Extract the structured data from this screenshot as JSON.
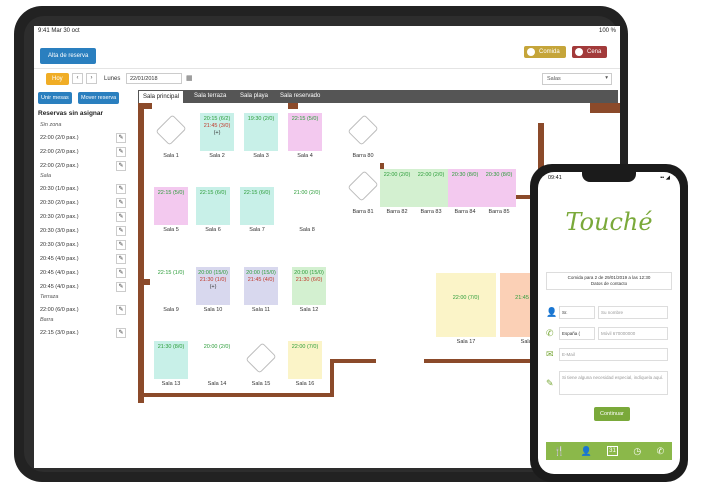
{
  "ipad": {
    "status_time": "9:41 Mar 30 oct",
    "status_right": "100 %",
    "alta_button": "Alta de reserva",
    "comida_label": "Comida",
    "cena_label": "Cena",
    "hoy_button": "Hoy",
    "prev_icon": "chevron-left-icon",
    "next_icon": "chevron-right-icon",
    "day_label": "Lunes",
    "date_value": "22/01/2018",
    "salas_select": "Salas",
    "sidebar": {
      "btn_unir": "Unir mesas",
      "btn_mover": "Mover reserva",
      "title": "Reservas sin asignar",
      "groups": [
        {
          "label": "Sin zona",
          "items": [
            "22:00 (2/0 pax.)",
            "22:00 (2/0 pax.)",
            "22:00 (2/0 pax.)"
          ]
        },
        {
          "label": "Sala",
          "items": [
            "20:30 (1/0 pax.)",
            "20:30 (2/0 pax.)",
            "20:30 (2/0 pax.)",
            "20:30 (3/0 pax.)",
            "20:30 (3/0 pax.)",
            "20:45 (4/0 pax.)",
            "20:45 (4/0 pax.)",
            "20:45 (4/0 pax.)"
          ]
        },
        {
          "label": "Terraza",
          "items": [
            "22:00 (6/0 pax.)"
          ]
        },
        {
          "label": "Barra",
          "items": [
            "22:15 (3/0 pax.)"
          ]
        }
      ]
    },
    "tabs": [
      "Sala principal",
      "Sala terraza",
      "Sala playa",
      "Sala reservado"
    ],
    "tables": [
      {
        "name": "Sala 1",
        "lines": [],
        "color": "none"
      },
      {
        "name": "Sala 2",
        "lines": [
          "20:15 (6/2)",
          "21:45 (3/0)",
          "(+)"
        ],
        "color": "g"
      },
      {
        "name": "Sala 3",
        "lines": [
          "19:30 (2/0)"
        ],
        "color": "g"
      },
      {
        "name": "Sala 4",
        "lines": [
          "22:15 (5/0)"
        ],
        "color": "p"
      },
      {
        "name": "Sala 5",
        "lines": [
          "22:15 (5/0)"
        ],
        "color": "p"
      },
      {
        "name": "Sala 6",
        "lines": [
          "22:15 (6/0)"
        ],
        "color": "g"
      },
      {
        "name": "Sala 7",
        "lines": [
          "22:15 (6/0)"
        ],
        "color": "g"
      },
      {
        "name": "Sala 8",
        "lines": [
          "21:00 (2/0)"
        ],
        "color": "none"
      },
      {
        "name": "Sala 9",
        "lines": [
          "22:15 (1/0)"
        ],
        "color": "none"
      },
      {
        "name": "Sala 10",
        "lines": [
          "20:00 (15/0)",
          "21:30 (1/0)",
          "(+)"
        ],
        "color": "v"
      },
      {
        "name": "Sala 11",
        "lines": [
          "20:00 (15/0)",
          "21:45 (4/0)"
        ],
        "color": "v"
      },
      {
        "name": "Sala 12",
        "lines": [
          "20:00 (15/0)",
          "21:30 (6/0)"
        ],
        "color": "lg"
      },
      {
        "name": "Sala 13",
        "lines": [
          "21:30 (8/0)"
        ],
        "color": "g"
      },
      {
        "name": "Sala 14",
        "lines": [
          "20:00 (2/0)"
        ],
        "color": "none"
      },
      {
        "name": "Sala 15",
        "lines": [],
        "color": "none"
      },
      {
        "name": "Sala 16",
        "lines": [
          "22:00 (7/0)"
        ],
        "color": "y"
      },
      {
        "name": "Sala 17",
        "lines": [
          "22:00 (7/0)"
        ],
        "color": "y"
      },
      {
        "name": "Sala 18",
        "lines": [
          "21:45 (12/0)"
        ],
        "color": "o"
      },
      {
        "name": "Barra 80",
        "lines": [],
        "color": "none"
      },
      {
        "name": "Barra 81",
        "lines": [],
        "color": "none"
      },
      {
        "name": "Barra 82",
        "lines": [
          "22:00 (2/0)"
        ],
        "color": "lg"
      },
      {
        "name": "Barra 83",
        "lines": [
          "22:00 (2/0)"
        ],
        "color": "lg"
      },
      {
        "name": "Barra 84",
        "lines": [
          "20:30 (8/0)"
        ],
        "color": "p"
      },
      {
        "name": "Barra 85",
        "lines": [
          "20:30 (8/0)"
        ],
        "color": "p"
      }
    ]
  },
  "phone": {
    "time": "09:41",
    "logo": "Touché",
    "banner_line1": "Comida para 2 de 29/01/2019 a las 12:30",
    "banner_line2": "Datos de contacto",
    "title_select": "Sr.",
    "name_placeholder": "Su nombre",
    "country_select": "España (",
    "mobile_placeholder": "Móvil 670000000",
    "email_placeholder": "E-Mail",
    "notes_placeholder": "Si tiene alguna necesidad especial, indíquela aquí.",
    "continue_button": "Continuar",
    "nav_icons": [
      "cutlery-icon",
      "user-icon",
      "calendar-icon",
      "clock-icon",
      "phone-icon"
    ],
    "calendar_day": "31"
  }
}
